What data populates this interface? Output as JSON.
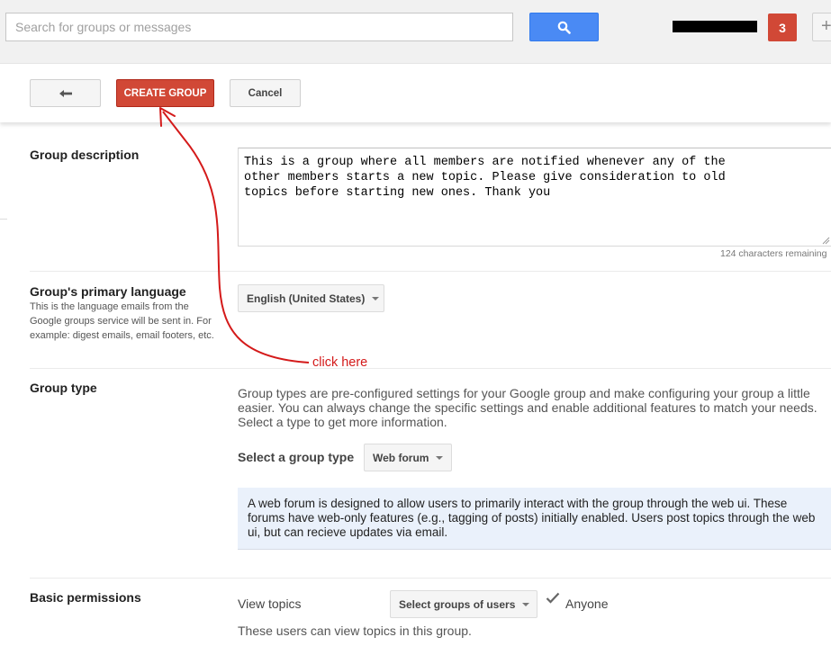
{
  "search": {
    "placeholder": "Search for groups or messages"
  },
  "header": {
    "notification_count": "3"
  },
  "actions": {
    "create_label": "CREATE GROUP",
    "cancel_label": "Cancel"
  },
  "description": {
    "label": "Group description",
    "value": "This is a group where all members are notified whenever any of the\nother members starts a new topic. Please give consideration to old\ntopics before starting new ones. Thank you",
    "char_count": "124 characters remaining"
  },
  "language": {
    "label": "Group's primary language",
    "help": "This is the language emails from the Google groups service will be sent in. For example: digest emails, email footers, etc.",
    "selected": "English (United States)"
  },
  "group_type": {
    "label": "Group type",
    "intro": "Group types are pre-configured settings for your Google group and make configuring your group a little easier. You can always change the specific settings and enable additional features to match your needs. Select a type to get more information.",
    "select_label": "Select a group type",
    "selected": "Web forum",
    "info": "A web forum is designed to allow users to primarily interact with the group through the web ui. These forums have web-only features (e.g., tagging of posts) initially enabled. Users post topics through the web ui, but can recieve updates via email."
  },
  "permissions": {
    "label": "Basic permissions",
    "view_topics_label": "View topics",
    "dropdown_label": "Select groups of users",
    "checked_option": "Anyone",
    "help": "These users can view topics in this group."
  },
  "annotation": {
    "text": "click here",
    "color": "#d41a1a"
  },
  "colors": {
    "primary_button": "#d14836",
    "search_button": "#4a8af4",
    "info_box": "#eaf1fb"
  },
  "icons": [
    "search-icon",
    "back-arrow-icon",
    "plus-icon",
    "caret-down-icon",
    "checkmark-icon"
  ]
}
